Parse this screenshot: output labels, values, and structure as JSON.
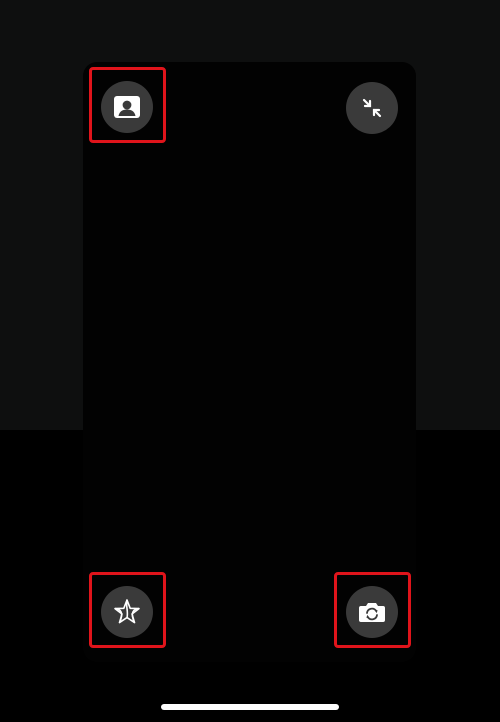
{
  "colors": {
    "background": "#000000",
    "backdrop": "#0e0f0f",
    "panel": "#020202",
    "button": "#3a3a3a",
    "icon": "#ffffff",
    "highlight": "#e0141b",
    "home_indicator": "#ffffff"
  },
  "controls": {
    "portrait": {
      "icon": "portrait-mode-icon",
      "highlighted": true
    },
    "minimize": {
      "icon": "collapse-arrows-icon",
      "highlighted": false
    },
    "effects": {
      "icon": "star-effects-icon",
      "highlighted": true
    },
    "flip_camera": {
      "icon": "camera-rotate-icon",
      "highlighted": true
    }
  }
}
